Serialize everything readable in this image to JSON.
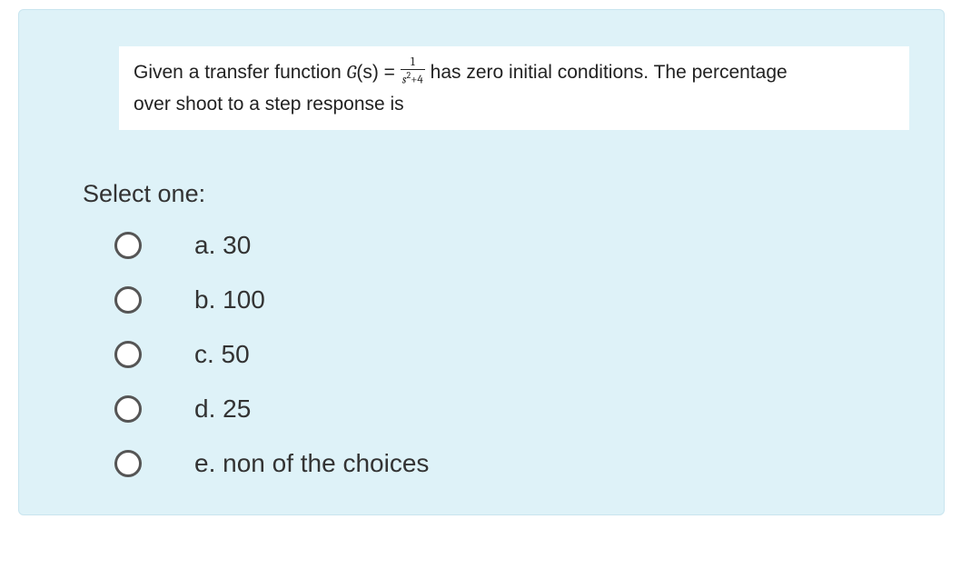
{
  "question": {
    "prefix": "Given a transfer function ",
    "gLabel": "G",
    "sLabel": "(s)",
    "equals": " = ",
    "fracNum": "1",
    "fracDenBase": "s",
    "fracDenExp": "2",
    "fracDenRest": "+4",
    "mid": " has zero initial conditions. The percentage ",
    "line2": "over shoot to a step response is"
  },
  "selectLabel": "Select one:",
  "options": [
    {
      "label": "a. 30"
    },
    {
      "label": "b. 100"
    },
    {
      "label": "c. 50"
    },
    {
      "label": "d. 25"
    },
    {
      "label": "e. non of the choices"
    }
  ]
}
